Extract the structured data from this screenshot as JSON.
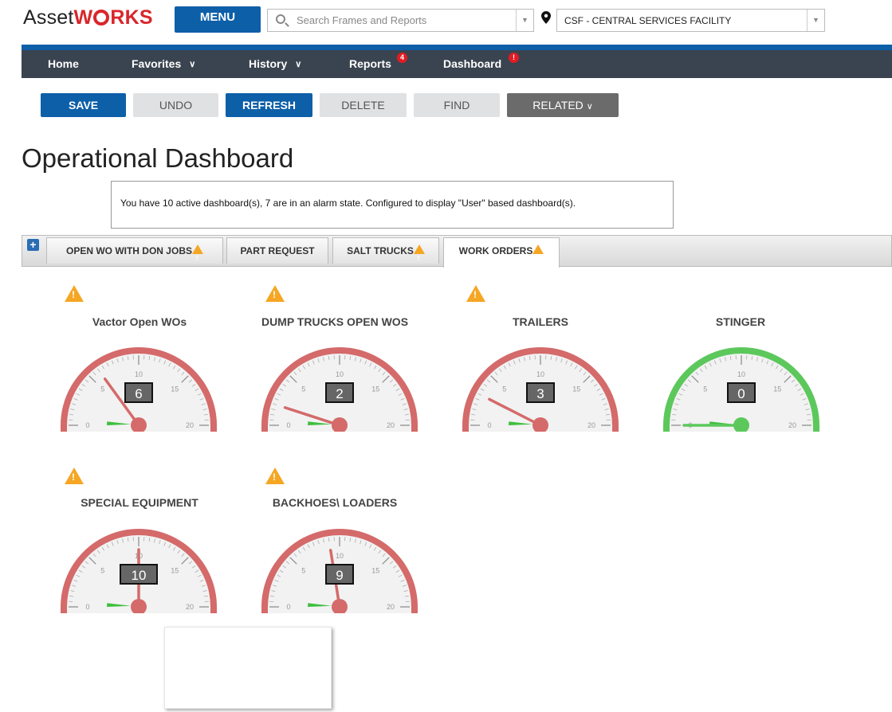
{
  "app": {
    "logo_prefix": "Asset",
    "logo_suffix": "RKS",
    "logo_w": "W"
  },
  "header": {
    "menu_label": "MENU",
    "search_placeholder": "Search Frames and Reports",
    "facility_value": "CSF - CENTRAL SERVICES FACILITY"
  },
  "nav": {
    "home": "Home",
    "favorites": "Favorites",
    "history": "History",
    "reports": "Reports",
    "reports_badge": "4",
    "dashboard": "Dashboard",
    "dashboard_badge": "!"
  },
  "toolbar": {
    "save": "SAVE",
    "undo": "UNDO",
    "refresh": "REFRESH",
    "delete": "DELETE",
    "find": "FIND",
    "related": "RELATED"
  },
  "page_title": "Operational Dashboard",
  "message": "You have 10 active dashboard(s), 7 are in an alarm state.  Configured to display \"User\" based dashboard(s).",
  "tabs": [
    {
      "label": "OPEN WO WITH DON JOBS",
      "warning": true
    },
    {
      "label": "PART REQUEST",
      "warning": false
    },
    {
      "label": "SALT TRUCKS",
      "warning": true
    },
    {
      "label": "WORK ORDERS",
      "warning": true,
      "active": true
    }
  ],
  "gauges": [
    {
      "title": "Vactor Open WOs",
      "value": "6",
      "alarm": true
    },
    {
      "title": "DUMP TRUCKS OPEN WOS",
      "value": "2",
      "alarm": true
    },
    {
      "title": "TRAILERS",
      "value": "3",
      "alarm": true
    },
    {
      "title": "STINGER",
      "value": "0",
      "alarm": false
    },
    {
      "title": "SPECIAL EQUIPMENT",
      "value": "10",
      "alarm": true
    },
    {
      "title": "BACKHOES\\ LOADERS",
      "value": "9",
      "alarm": true
    }
  ],
  "gauge_scale": {
    "min": 0,
    "max": 20,
    "labels": [
      "0",
      "5",
      "10",
      "15",
      "20"
    ]
  },
  "colors": {
    "alarm": "#d46a6a",
    "ok": "#5cc85c",
    "brand_blue": "#0d5fa8",
    "nav_bg": "#3a4450",
    "warning": "#f5a623"
  }
}
